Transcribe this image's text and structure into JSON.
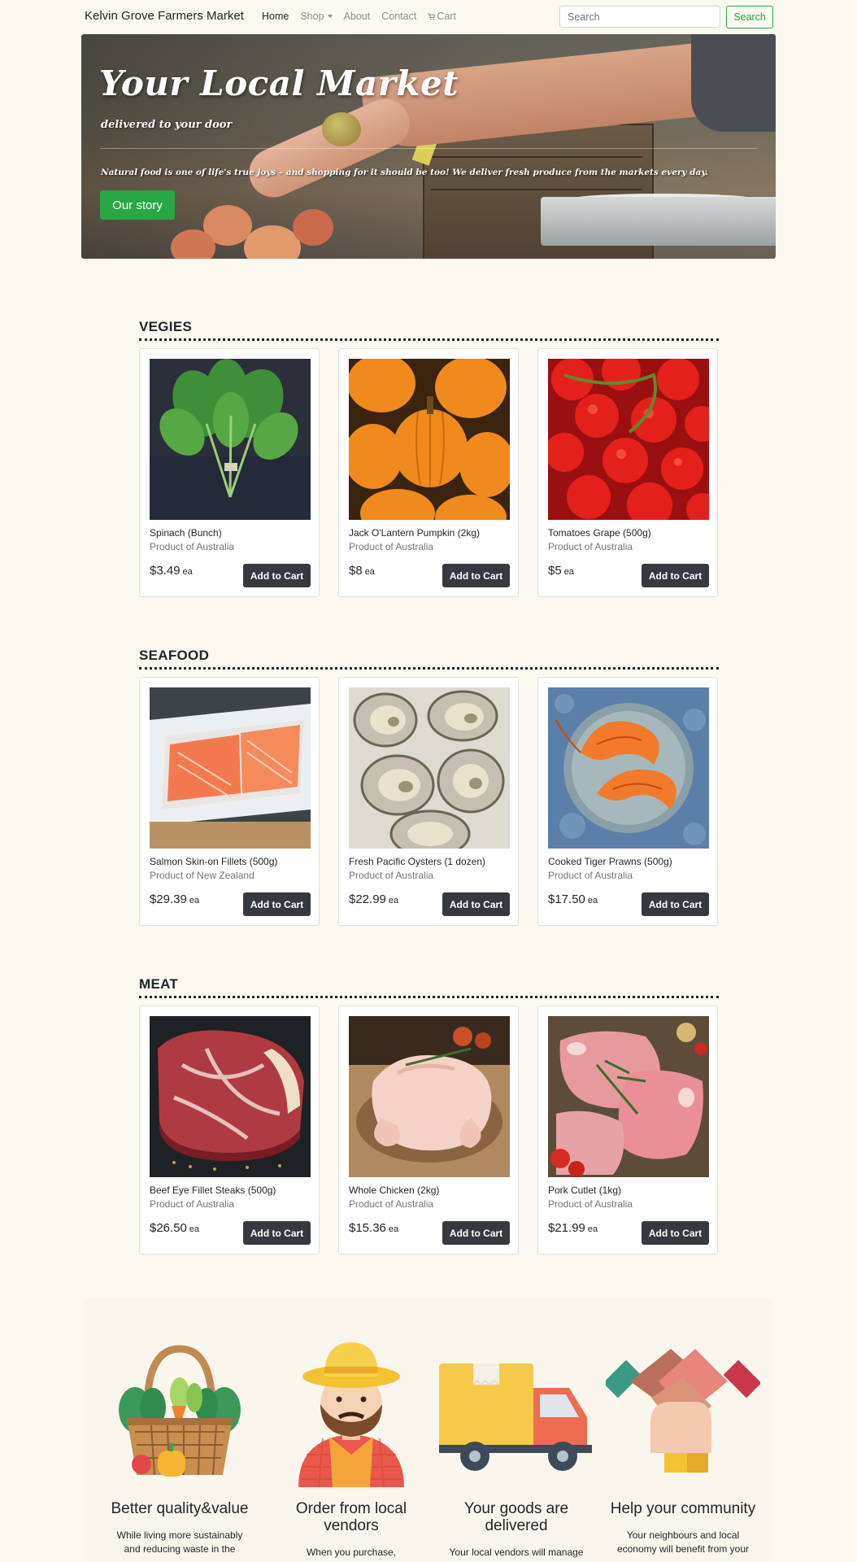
{
  "navbar": {
    "brand": "Kelvin Grove Farmers Market",
    "links": {
      "home": "Home",
      "shop": "Shop",
      "about": "About",
      "contact": "Contact",
      "cart": "Cart"
    },
    "search_placeholder": "Search",
    "search_button": "Search"
  },
  "hero": {
    "title": "Your Local Market",
    "subtitle": "delivered to your door",
    "text": "Natural food is one of life's true joys – and shopping for it should be too! We deliver fresh produce from the markets every day.",
    "button": "Our story"
  },
  "sections": [
    {
      "title": "VEGIES",
      "products": [
        {
          "name": "Spinach (Bunch)",
          "origin": "Product of Australia",
          "price": "$3.49",
          "unit": "ea",
          "button": "Add to Cart",
          "image": "spinach"
        },
        {
          "name": "Jack O'Lantern Pumpkin (2kg)",
          "origin": "Product of Australia",
          "price": "$8",
          "unit": "ea",
          "button": "Add to Cart",
          "image": "pumpkins"
        },
        {
          "name": "Tomatoes Grape (500g)",
          "origin": "Product of Australia",
          "price": "$5",
          "unit": "ea",
          "button": "Add to Cart",
          "image": "tomatoes"
        }
      ]
    },
    {
      "title": "SEAFOOD",
      "products": [
        {
          "name": "Salmon Skin-on Fillets (500g)",
          "origin": "Product of New Zealand",
          "price": "$29.39",
          "unit": "ea",
          "button": "Add to Cart",
          "image": "salmon"
        },
        {
          "name": "Fresh Pacific Oysters (1 dozen)",
          "origin": "Product of Australia",
          "price": "$22.99",
          "unit": "ea",
          "button": "Add to Cart",
          "image": "oysters"
        },
        {
          "name": "Cooked Tiger Prawns (500g)",
          "origin": "Product of Australia",
          "price": "$17.50",
          "unit": "ea",
          "button": "Add to Cart",
          "image": "prawns"
        }
      ]
    },
    {
      "title": "MEAT",
      "products": [
        {
          "name": "Beef Eye Fillet Steaks (500g)",
          "origin": "Product of Australia",
          "price": "$26.50",
          "unit": "ea",
          "button": "Add to Cart",
          "image": "beef"
        },
        {
          "name": "Whole Chicken (2kg)",
          "origin": "Product of Australia",
          "price": "$15.36",
          "unit": "ea",
          "button": "Add to Cart",
          "image": "chicken"
        },
        {
          "name": "Pork Cutlet (1kg)",
          "origin": "Product of Australia",
          "price": "$21.99",
          "unit": "ea",
          "button": "Add to Cart",
          "image": "pork"
        }
      ]
    }
  ],
  "features": [
    {
      "title": "Better quality&value",
      "text_lines": [
        "While living more sustainably",
        "and reducing waste in the"
      ],
      "icon": "basket-icon"
    },
    {
      "title_lines": [
        "Order from local",
        "vendors"
      ],
      "text_lines": [
        "When you purchase,"
      ],
      "icon": "farmer-icon"
    },
    {
      "title_lines": [
        "Your goods are",
        "delivered"
      ],
      "text_lines": [
        "Your local vendors will manage"
      ],
      "icon": "truck-icon"
    },
    {
      "title": "Help your community",
      "text_lines": [
        "Your neighbours and local",
        "economy will benefit from your"
      ],
      "icon": "handshake-icon"
    }
  ],
  "colors": {
    "background": "#fcf9f1",
    "accent": "#28a745",
    "dark_button": "#343a40"
  }
}
